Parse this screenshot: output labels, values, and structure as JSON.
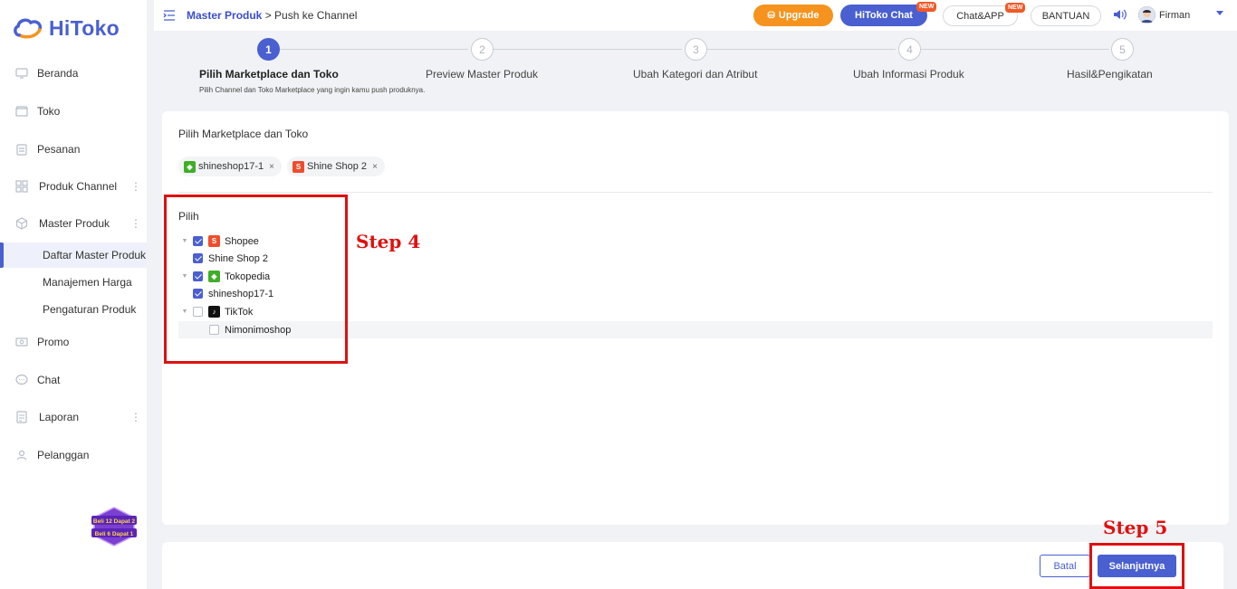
{
  "app": {
    "logo_text": "HiToko",
    "brand_color": "#4a5fd0"
  },
  "sidebar": {
    "items": [
      {
        "label": "Beranda",
        "icon": "monitor-icon"
      },
      {
        "label": "Toko",
        "icon": "store-icon"
      },
      {
        "label": "Pesanan",
        "icon": "clipboard-icon"
      },
      {
        "label": "Produk Channel",
        "icon": "grid-icon"
      },
      {
        "label": "Master Produk",
        "icon": "cube-icon"
      },
      {
        "label": "Promo",
        "icon": "promo-icon"
      },
      {
        "label": "Chat",
        "icon": "chat-icon"
      },
      {
        "label": "Laporan",
        "icon": "report-icon"
      },
      {
        "label": "Pelanggan",
        "icon": "customers-icon"
      }
    ],
    "sub_items": [
      {
        "label": "Daftar Master Produk",
        "active": true
      },
      {
        "label": "Manajemen Harga"
      },
      {
        "label": "Pengaturan Produk"
      }
    ],
    "promo_badge": {
      "line1": "Beli 12 Dapat 2",
      "line2": "Beli 6 Dapat 1"
    }
  },
  "topbar": {
    "breadcrumb_parent": "Master Produk",
    "breadcrumb_sep": " > ",
    "breadcrumb_current": "Push ke Channel",
    "upgrade": "Upgrade",
    "hitoko_chat": "HiToko Chat",
    "chat_app": "Chat&APP",
    "new_badge": "NEW",
    "bantuan": "BANTUAN",
    "username": "Firman"
  },
  "stepper": {
    "steps": [
      {
        "num": "1",
        "title": "Pilih Marketplace dan Toko",
        "active": true
      },
      {
        "num": "2",
        "title": "Preview Master Produk"
      },
      {
        "num": "3",
        "title": "Ubah Kategori dan Atribut"
      },
      {
        "num": "4",
        "title": "Ubah Informasi Produk"
      },
      {
        "num": "5",
        "title": "Hasil&Pengikatan"
      }
    ],
    "active_desc": "Pilih Channel dan Toko Marketplace yang ingin kamu push produknya."
  },
  "main": {
    "title": "Pilih Marketplace dan Toko",
    "selected_tags": [
      {
        "label": "shineshop17-1",
        "platform": "tokopedia"
      },
      {
        "label": "Shine Shop 2",
        "platform": "shopee"
      }
    ],
    "tree_label": "Pilih",
    "tree": [
      {
        "label": "Shopee",
        "checked": true,
        "children": [
          {
            "label": "Shine Shop 2",
            "checked": true
          }
        ]
      },
      {
        "label": "Tokopedia",
        "checked": true,
        "children": [
          {
            "label": "shineshop17-1",
            "checked": true
          }
        ]
      },
      {
        "label": "TikTok",
        "checked": false,
        "children": [
          {
            "label": "Nimonimoshop",
            "checked": false
          }
        ]
      }
    ]
  },
  "annotations": {
    "step4": "Step 4",
    "step5": "Step 5",
    "color": "#e01010"
  },
  "footer": {
    "cancel": "Batal",
    "next": "Selanjutnya"
  }
}
